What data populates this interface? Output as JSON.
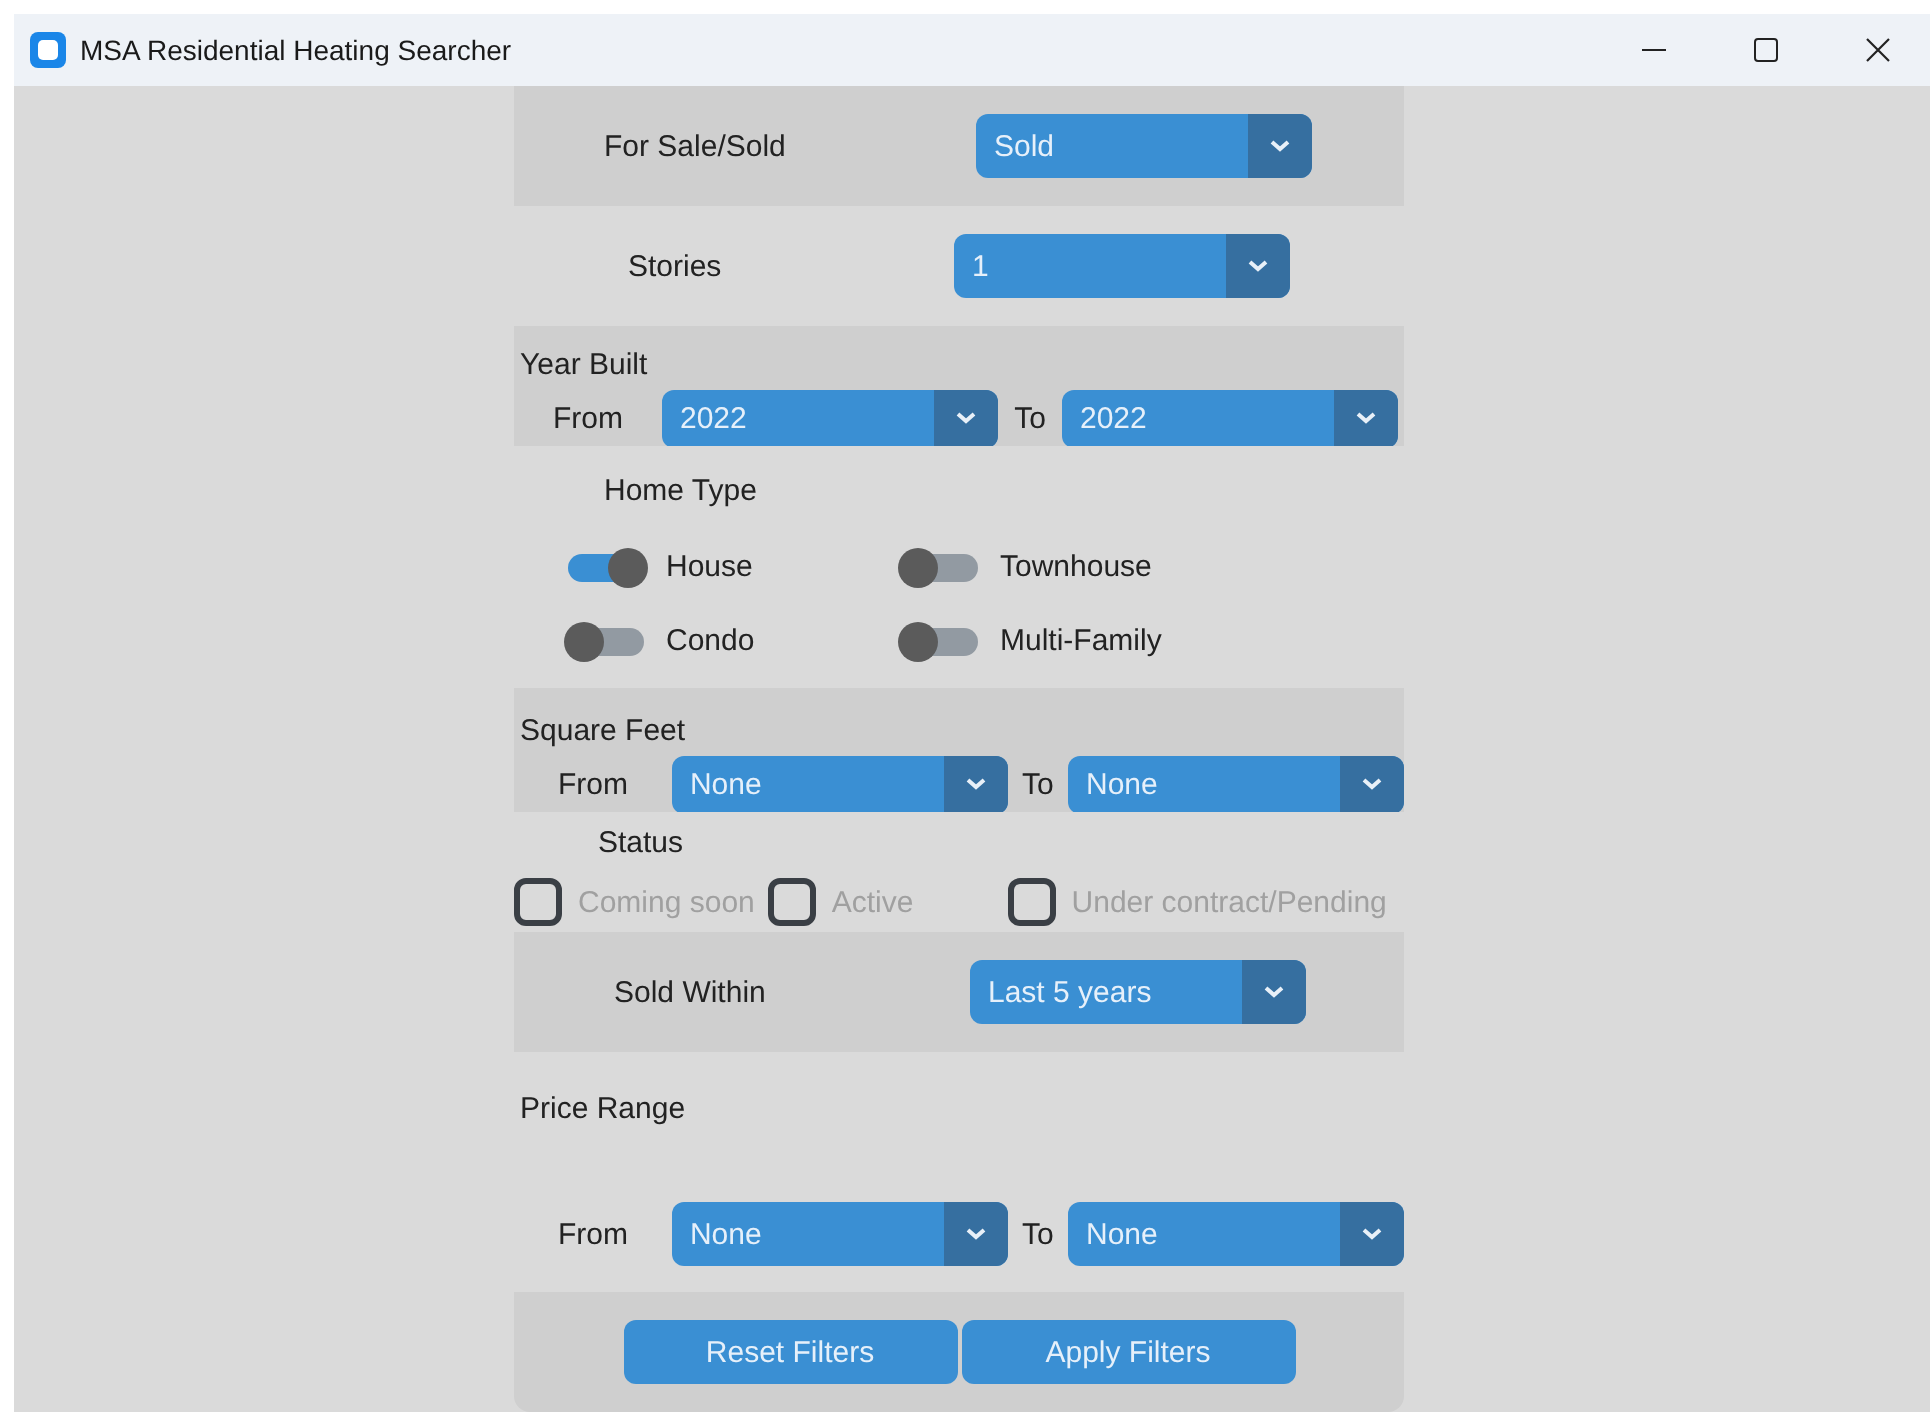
{
  "window": {
    "title": "MSA Residential Heating Searcher"
  },
  "sale_status": {
    "label": "For Sale/Sold",
    "value": "Sold"
  },
  "stories": {
    "label": "Stories",
    "value": "1"
  },
  "year_built": {
    "label": "Year Built",
    "from_label": "From",
    "from": "2022",
    "to_label": "To",
    "to": "2022"
  },
  "home_type": {
    "label": "Home Type",
    "options": [
      {
        "label": "House",
        "on": true
      },
      {
        "label": "Townhouse",
        "on": false
      },
      {
        "label": "Condo",
        "on": false
      },
      {
        "label": "Multi-Family",
        "on": false
      }
    ]
  },
  "square_feet": {
    "label": "Square Feet",
    "from_label": "From",
    "from": "None",
    "to_label": "To",
    "to": "None"
  },
  "status": {
    "label": "Status",
    "options": [
      {
        "label": "Coming soon",
        "checked": false,
        "disabled": true
      },
      {
        "label": "Active",
        "checked": false,
        "disabled": true
      },
      {
        "label": "Under contract/Pending",
        "checked": false,
        "disabled": true
      }
    ]
  },
  "sold_within": {
    "label": "Sold Within",
    "value": "Last 5 years"
  },
  "price_range": {
    "label": "Price Range",
    "from_label": "From",
    "from": "None",
    "to_label": "To",
    "to": "None"
  },
  "buttons": [
    "Reset Filters",
    "Apply Filters"
  ]
}
